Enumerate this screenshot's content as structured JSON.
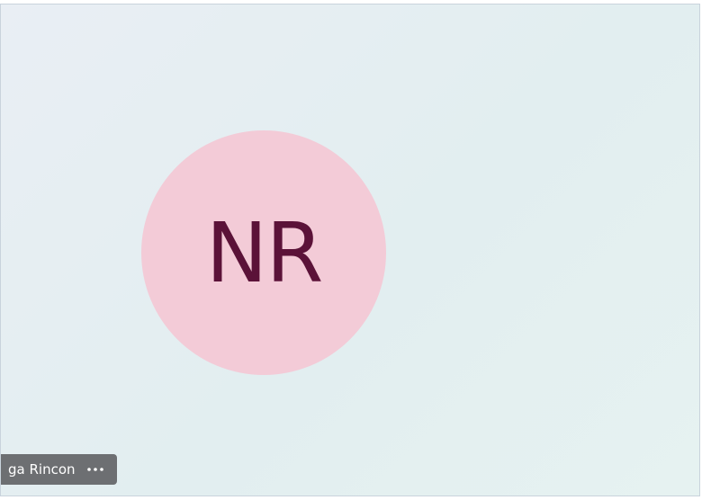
{
  "participant": {
    "initials": "NR",
    "display_name": "ga Rincon",
    "more_options_icon": "more-horizontal-icon"
  },
  "colors": {
    "tile_background": "#e5eff2",
    "avatar_background": "#f3cbd7",
    "avatar_text": "#5b1238",
    "name_pill_background": "#6d6f72"
  }
}
